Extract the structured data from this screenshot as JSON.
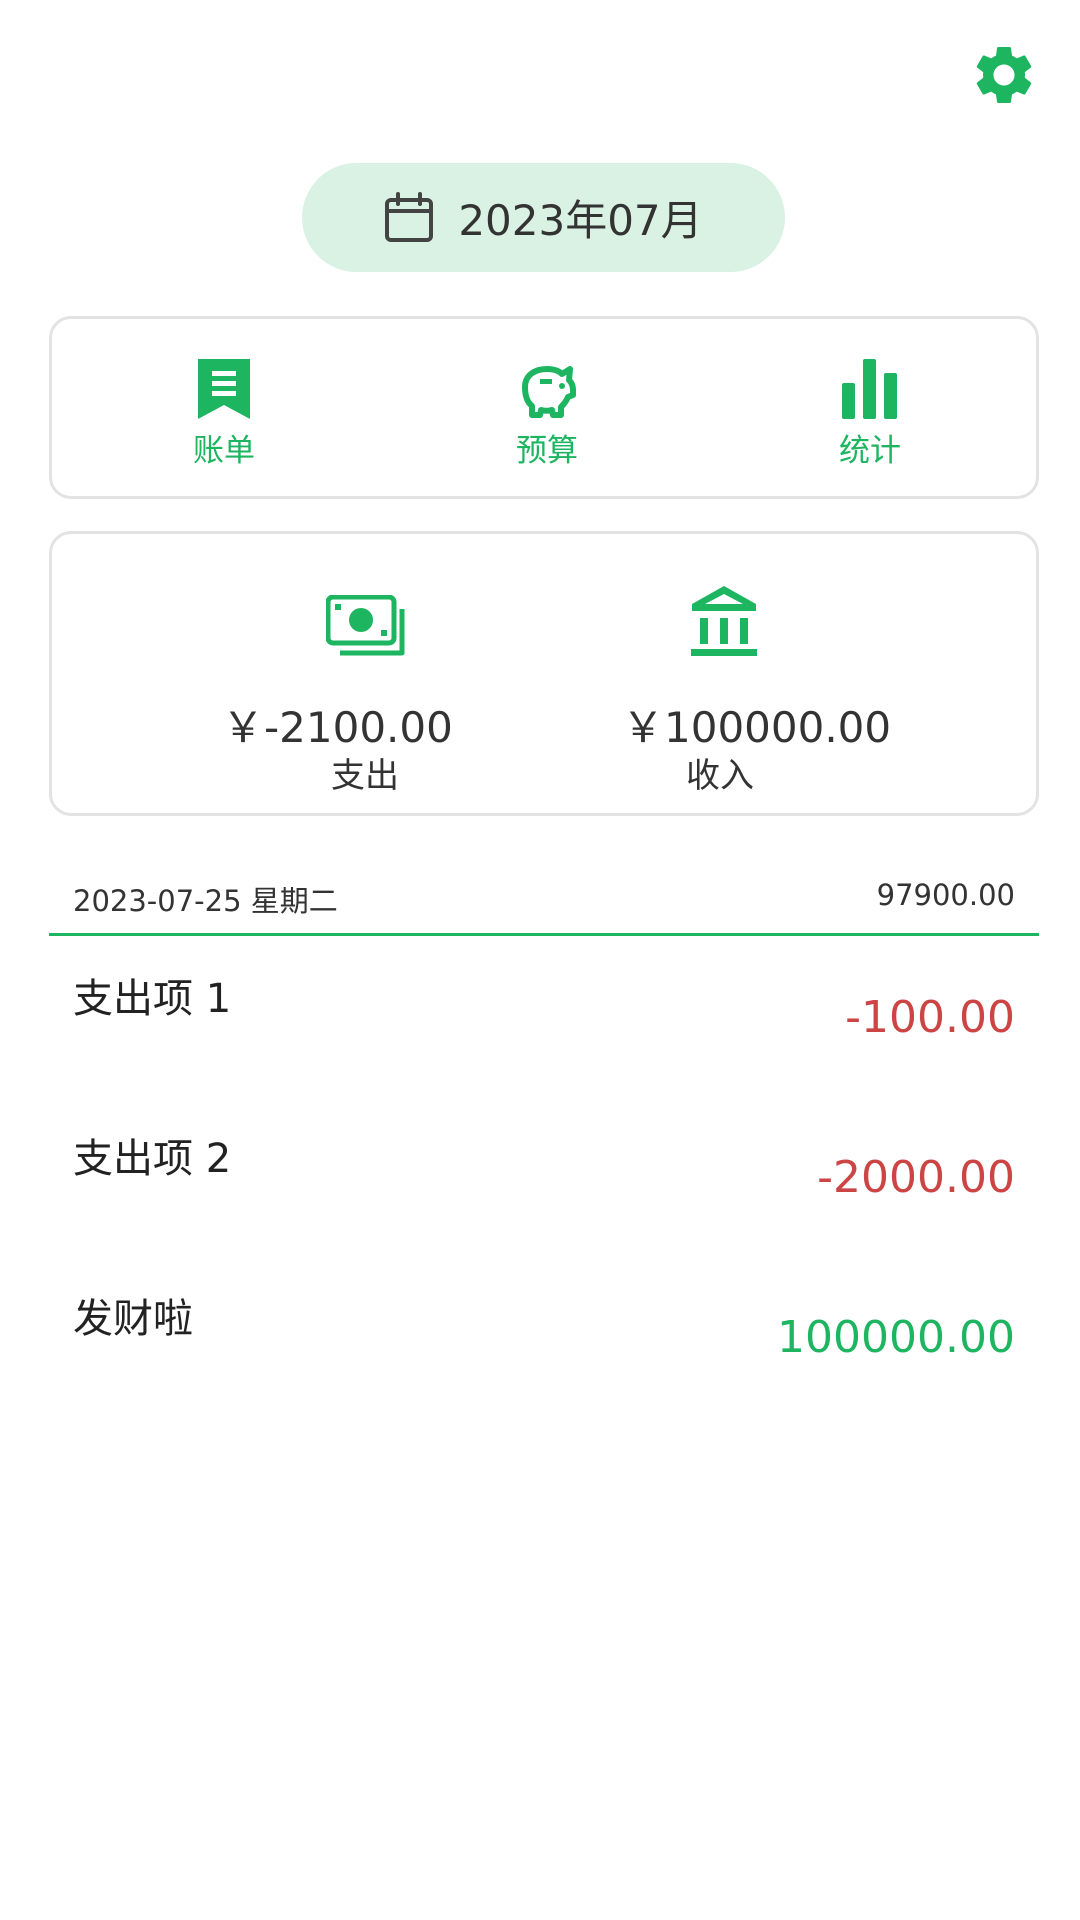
{
  "header": {
    "settings_icon": "gear-icon"
  },
  "month_picker": {
    "icon": "calendar-icon",
    "label": "2023年07月"
  },
  "nav": {
    "items": [
      {
        "icon": "receipt-icon",
        "label": "账单"
      },
      {
        "icon": "piggy-bank-icon",
        "label": "预算"
      },
      {
        "icon": "bar-chart-icon",
        "label": "统计"
      }
    ]
  },
  "summary": {
    "expense": {
      "icon": "cash-icon",
      "amount": "￥-2100.00",
      "label": "支出"
    },
    "income": {
      "icon": "bank-icon",
      "amount": "￥100000.00",
      "label": "收入"
    }
  },
  "day": {
    "date": "2023-07-25 星期二",
    "total": "97900.00"
  },
  "entries": [
    {
      "name": "支出项 1",
      "amount": "-100.00",
      "type": "expense"
    },
    {
      "name": "支出项 2",
      "amount": "-2000.00",
      "type": "expense"
    },
    {
      "name": "发财啦",
      "amount": "100000.00",
      "type": "income"
    }
  ],
  "colors": {
    "accent": "#1db560",
    "expense": "#cc4444",
    "month_bg": "#d9f2e4"
  }
}
